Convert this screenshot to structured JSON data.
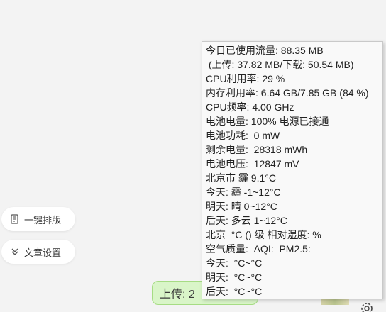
{
  "sidebar": {
    "buttons": [
      {
        "label": "一键排版",
        "icon": "document-format-icon"
      },
      {
        "label": "文章设置",
        "icon": "chevron-double-down-icon"
      }
    ]
  },
  "status_bubble": {
    "text": "上传: 2"
  },
  "tooltip": {
    "lines": [
      "今日已使用流量: 88.35 MB",
      " (上传: 37.82 MB/下载: 50.54 MB)",
      "CPU利用率: 29 %",
      "内存利用率: 6.64 GB/7.85 GB (84 %)",
      "CPU频率: 4.00 GHz",
      "电池电量: 100% 电源已接通",
      "电池功耗:  0 mW",
      "剩余电量:  28318 mWh",
      "电池电压:  12847 mV",
      "北京市 霾 9.1°C",
      "今天: 霾 -1~12°C",
      "明天: 晴 0~12°C",
      "后天: 多云 1~12°C",
      "北京  °C () 级 相对湿度: %",
      "空气质量:  AQI:  PM2.5: ",
      "今天:  °C~°C",
      "明天:  °C~°C",
      "后天:  °C~°C"
    ]
  }
}
